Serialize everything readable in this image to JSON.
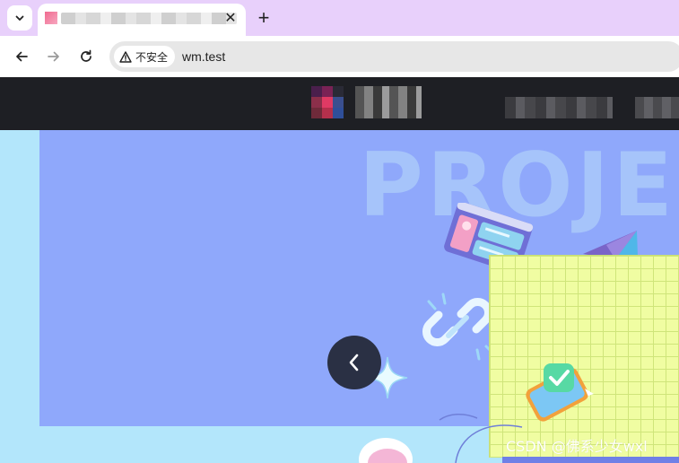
{
  "browser": {
    "tab": {
      "close_label": "✕"
    },
    "new_tab_label": "+",
    "security_label": "不安全",
    "url": "wm.test"
  },
  "site": {
    "hero": {
      "title": "PROJE",
      "prev_label": "‹"
    }
  },
  "watermark": "CSDN @佛系少女wxl",
  "icons": {
    "tab_list": "chevron-down-icon",
    "back": "arrow-left-icon",
    "forward": "arrow-right-icon",
    "reload": "reload-icon",
    "security": "warning-icon"
  },
  "colors": {
    "tabstrip": "#e8d0fb",
    "site_header": "#1e1f24",
    "hero_bg": "#8fa8fb",
    "page_bg": "#b3e6fb",
    "grid_panel": "#f0fda2",
    "nav_button": "#2a3044"
  }
}
